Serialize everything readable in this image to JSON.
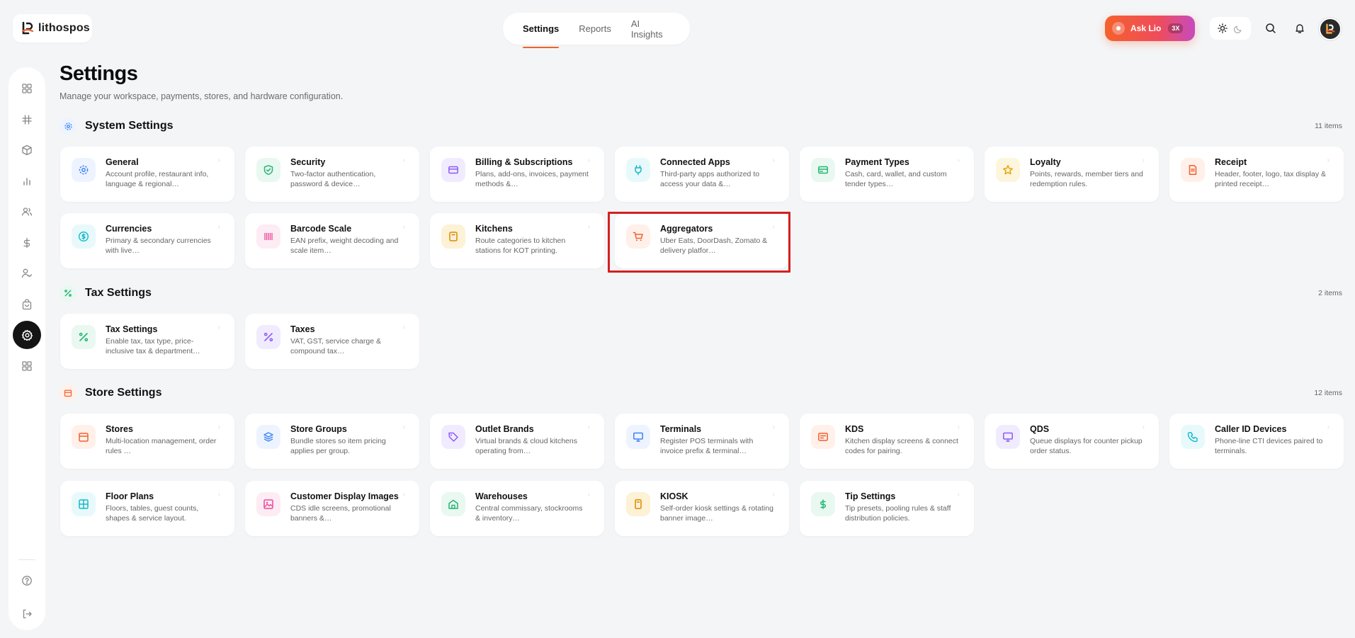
{
  "brand": {
    "name": "lithospos",
    "accent": "#f2602d"
  },
  "topnav": {
    "tabs": [
      {
        "label": "Settings",
        "active": true
      },
      {
        "label": "Reports"
      },
      {
        "label": "AI Insights"
      }
    ]
  },
  "ask": {
    "label": "Ask Lio",
    "badge": "3X"
  },
  "header": {
    "title": "Settings",
    "subtitle": "Manage your workspace, payments, stores, and hardware configuration."
  },
  "sections": {
    "system": {
      "title": "System Settings",
      "count": "11 items",
      "cards": [
        {
          "title": "General",
          "desc": "Account profile, restaurant info, language & regional…",
          "icon": "gear-icon",
          "color": "#3b82f6",
          "bg": "#eef4ff"
        },
        {
          "title": "Security",
          "desc": "Two-factor authentication, password & device…",
          "icon": "shield-icon",
          "color": "#22b573",
          "bg": "#e9f8f0"
        },
        {
          "title": "Billing & Subscriptions",
          "desc": "Plans, add-ons, invoices, payment methods &…",
          "icon": "credit-card-icon",
          "color": "#8b5cf6",
          "bg": "#f1ebff"
        },
        {
          "title": "Connected Apps",
          "desc": "Third-party apps authorized to access your data &…",
          "icon": "plug-icon",
          "color": "#14b8c9",
          "bg": "#e8f9fb"
        },
        {
          "title": "Payment Types",
          "desc": "Cash, card, wallet, and custom tender types…",
          "icon": "wallet-icon",
          "color": "#22b573",
          "bg": "#e9f8f0"
        },
        {
          "title": "Loyalty",
          "desc": "Points, rewards, member tiers and redemption rules.",
          "icon": "star-icon",
          "color": "#e6a100",
          "bg": "#fdf5dc"
        },
        {
          "title": "Receipt",
          "desc": "Header, footer, logo, tax display & printed receipt…",
          "icon": "receipt-icon",
          "color": "#f2602d",
          "bg": "#fff0ea"
        },
        {
          "title": "Currencies",
          "desc": "Primary & secondary currencies with live…",
          "icon": "dollar-circle-icon",
          "color": "#14b8c9",
          "bg": "#e8f9fb"
        },
        {
          "title": "Barcode Scale",
          "desc": "EAN prefix, weight decoding and scale item…",
          "icon": "barcode-icon",
          "color": "#ec4899",
          "bg": "#fdecf4"
        },
        {
          "title": "Kitchens",
          "desc": "Route categories to kitchen stations for KOT printing.",
          "icon": "kitchen-icon",
          "color": "#d98a00",
          "bg": "#fdf1d6"
        },
        {
          "title": "Aggregators",
          "desc": "Uber Eats, DoorDash, Zomato & delivery platfor…",
          "icon": "cart-icon",
          "color": "#f2602d",
          "bg": "#fff0ea"
        }
      ]
    },
    "tax": {
      "title": "Tax Settings",
      "count": "2 items",
      "cards": [
        {
          "title": "Tax Settings",
          "desc": "Enable tax, tax type, price-inclusive tax & department…",
          "icon": "percent-icon",
          "color": "#22b573",
          "bg": "#e9f8f0"
        },
        {
          "title": "Taxes",
          "desc": "VAT, GST, service charge & compound tax…",
          "icon": "percent-icon",
          "color": "#8b5cf6",
          "bg": "#f1ebff"
        }
      ]
    },
    "store": {
      "title": "Store Settings",
      "count": "12 items",
      "cards": [
        {
          "title": "Stores",
          "desc": "Multi-location management, order rules …",
          "icon": "store-icon",
          "color": "#f2602d",
          "bg": "#fff0ea"
        },
        {
          "title": "Store Groups",
          "desc": "Bundle stores so item pricing applies per group.",
          "icon": "layers-icon",
          "color": "#3b82f6",
          "bg": "#eef4ff"
        },
        {
          "title": "Outlet Brands",
          "desc": "Virtual brands & cloud kitchens operating from…",
          "icon": "tag-icon",
          "color": "#8b5cf6",
          "bg": "#f1ebff"
        },
        {
          "title": "Terminals",
          "desc": "Register POS terminals with invoice prefix & terminal…",
          "icon": "monitor-icon",
          "color": "#3b82f6",
          "bg": "#eef4ff"
        },
        {
          "title": "KDS",
          "desc": "Kitchen display screens & connect codes for pairing.",
          "icon": "kds-icon",
          "color": "#f2602d",
          "bg": "#fff0ea"
        },
        {
          "title": "QDS",
          "desc": "Queue displays for counter pickup order status.",
          "icon": "monitor-icon",
          "color": "#8b5cf6",
          "bg": "#f1ebff"
        },
        {
          "title": "Caller ID Devices",
          "desc": "Phone-line CTI devices paired to terminals.",
          "icon": "phone-icon",
          "color": "#14b8c9",
          "bg": "#e8f9fb"
        },
        {
          "title": "Floor Plans",
          "desc": "Floors, tables, guest counts, shapes & service layout.",
          "icon": "grid-icon",
          "color": "#14b8c9",
          "bg": "#e8f9fb"
        },
        {
          "title": "Customer Display Images",
          "desc": "CDS idle screens, promotional banners &…",
          "icon": "image-icon",
          "color": "#ec4899",
          "bg": "#fdecf4"
        },
        {
          "title": "Warehouses",
          "desc": "Central commissary, stockrooms & inventory…",
          "icon": "warehouse-icon",
          "color": "#22b573",
          "bg": "#e9f8f0"
        },
        {
          "title": "KIOSK",
          "desc": "Self-order kiosk settings & rotating banner image…",
          "icon": "kiosk-icon",
          "color": "#d98a00",
          "bg": "#fdf1d6"
        },
        {
          "title": "Tip Settings",
          "desc": "Tip presets, pooling rules & staff distribution policies.",
          "icon": "dollar-icon",
          "color": "#22b573",
          "bg": "#e9f8f0"
        }
      ]
    }
  },
  "sidebar": {
    "items": [
      "dashboard-icon",
      "hashtag-icon",
      "box-icon",
      "chart-icon",
      "users-icon",
      "dollar-icon",
      "user-check-icon",
      "bag-icon",
      "settings-icon",
      "apps-icon"
    ],
    "active_index": 8,
    "bottom": [
      "help-icon",
      "logout-icon"
    ]
  }
}
